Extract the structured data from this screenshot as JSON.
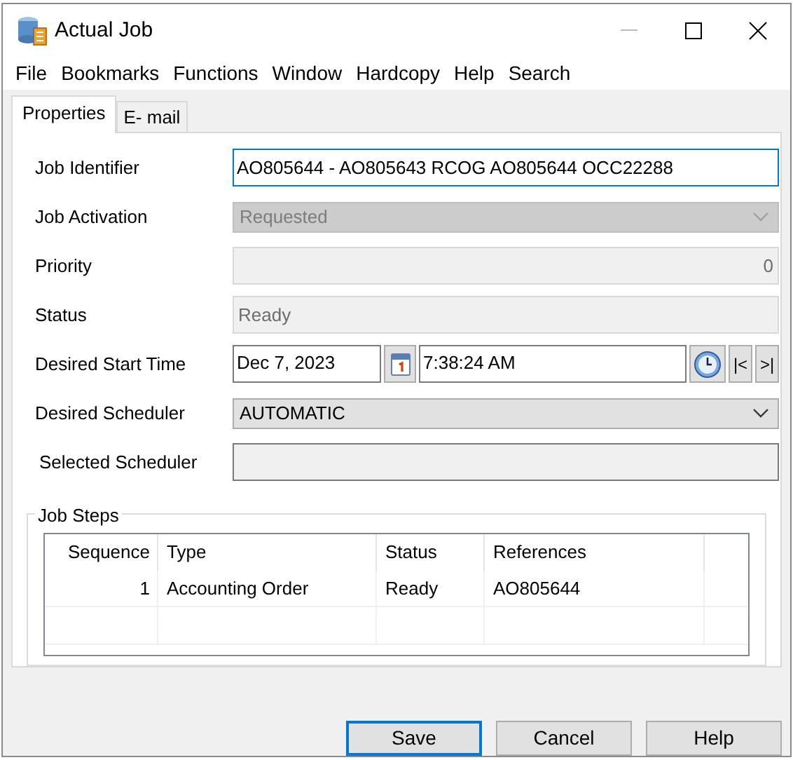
{
  "window": {
    "title": "Actual Job"
  },
  "menu": [
    "File",
    "Bookmarks",
    "Functions",
    "Window",
    "Hardcopy",
    "Help",
    "Search"
  ],
  "tabs": [
    {
      "label": "Properties",
      "selected": true
    },
    {
      "label": "E- mail",
      "selected": false
    }
  ],
  "fields": [
    {
      "kind": "text",
      "label": "Job Identifier",
      "value": "AO805644 - AO805643 RCOG AO805644 OCC22288",
      "focused": true
    },
    {
      "kind": "select",
      "label": "Job Activation",
      "value": "Requested",
      "disabled": true
    },
    {
      "kind": "number",
      "label": "Priority",
      "value": "0"
    },
    {
      "kind": "readonly",
      "label": "Status",
      "value": "Ready"
    },
    {
      "kind": "datetime",
      "label": "Desired Start Time",
      "date": "Dec 7, 2023",
      "time": "7:38:24 AM",
      "first": "|<",
      "last": ">|"
    },
    {
      "kind": "select",
      "label": "Desired Scheduler",
      "value": "AUTOMATIC",
      "disabled": false
    },
    {
      "kind": "blank",
      "label": "Selected Scheduler"
    }
  ],
  "job_steps": {
    "title": "Job Steps",
    "columns": [
      "Sequence",
      "Type",
      "Status",
      "References"
    ],
    "rows": [
      [
        "1",
        "Accounting Order",
        "Ready",
        "AO805644"
      ]
    ]
  },
  "buttons": [
    {
      "label": "Save",
      "default": true
    },
    {
      "label": "Cancel",
      "default": false
    },
    {
      "label": "Help",
      "default": false
    }
  ]
}
